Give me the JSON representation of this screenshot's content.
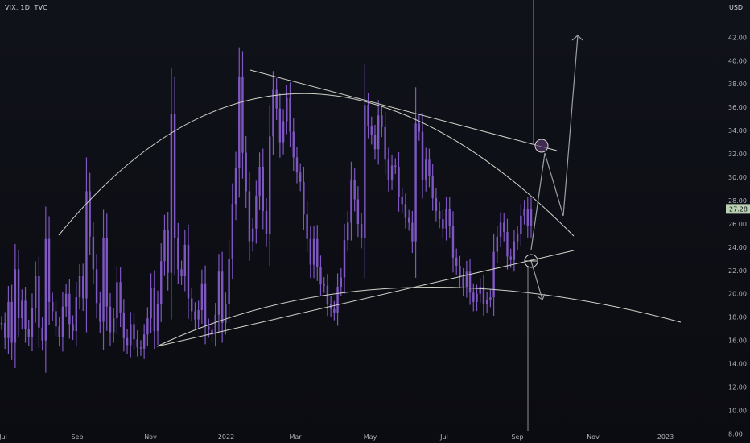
{
  "header": {
    "ticker": "VIX, 1D, TVC"
  },
  "price_axis": {
    "unit": "USD"
  },
  "chart_data": {
    "type": "line",
    "title": "VIX, 1D, TVC",
    "ylabel": "USD",
    "ylim": [
      7.2,
      45.2
    ],
    "y_scale": "linear",
    "grid": false,
    "y_ticks": [
      "8.00",
      "10.00",
      "12.00",
      "14.00",
      "16.00",
      "18.00",
      "20.00",
      "22.00",
      "24.00",
      "26.00",
      "28.00",
      "30.00",
      "32.00",
      "34.00",
      "36.00",
      "38.00",
      "40.00",
      "42.00"
    ],
    "x_ticks": [
      "Jul",
      "Sep",
      "Nov",
      "2022",
      "Mar",
      "May",
      "Jul",
      "Sep",
      "Nov",
      "2023"
    ],
    "last_price": "27.28",
    "series": [
      {
        "values": [
          17.5,
          16.2,
          19.3,
          15.8,
          22.1,
          17.9,
          19.4,
          17.0,
          16.3,
          18.8,
          21.5,
          17.1,
          16.0,
          24.7,
          19.3,
          18.5,
          17.2,
          16.3,
          18.9,
          20.0,
          17.4,
          16.8,
          19.7,
          21.5,
          19.6,
          28.8,
          24.9,
          22.1,
          19.2,
          17.6,
          24.8,
          18.9,
          16.7,
          17.9,
          21.0,
          18.4,
          16.2,
          15.6,
          17.4,
          16.1,
          15.4,
          15.3,
          16.5,
          17.9,
          20.5,
          16.8,
          19.1,
          22.8,
          25.5,
          21.8,
          35.4,
          24.8,
          22.1,
          21.5,
          24.2,
          19.6,
          18.5,
          17.8,
          18.6,
          20.9,
          17.2,
          16.9,
          16.5,
          18.2,
          21.9,
          17.5,
          19.1,
          23.0,
          27.7,
          30.8,
          38.6,
          32.1,
          28.8,
          24.5,
          25.6,
          28.4,
          30.9,
          27.1,
          25.1,
          33.5,
          37.5,
          35.9,
          33.0,
          34.8,
          36.8,
          33.9,
          31.7,
          30.4,
          29.6,
          26.8,
          24.7,
          22.5,
          24.7,
          22.3,
          20.8,
          20.7,
          19.1,
          18.7,
          18.4,
          20.6,
          21.4,
          24.6,
          26.1,
          29.8,
          28.1,
          26.0,
          24.8,
          36.2,
          34.4,
          33.6,
          32.4,
          35.3,
          34.3,
          31.5,
          29.8,
          31.0,
          30.9,
          28.3,
          27.7,
          26.5,
          26.1,
          24.5,
          34.6,
          33.9,
          29.8,
          31.5,
          30.1,
          28.2,
          27.1,
          26.4,
          25.6,
          27.3,
          25.8,
          23.1,
          22.4,
          21.4,
          20.6,
          21.9,
          20.1,
          19.3,
          20.0,
          20.6,
          19.1,
          19.5,
          19.7,
          23.6,
          24.9,
          26.1,
          25.3,
          23.2,
          22.9,
          24.5,
          25.1,
          26.7,
          27.3,
          25.8,
          27.28
        ]
      }
    ],
    "annotations": [
      {
        "kind": "arc",
        "desc": "rounded top arc over price"
      },
      {
        "kind": "arc",
        "desc": "rounded bottom arc"
      },
      {
        "kind": "trendline",
        "from": [
          "2022-01",
          38.7
        ],
        "to": [
          "2022-09",
          31.8
        ]
      },
      {
        "kind": "trendline",
        "from": [
          "2021-11",
          14.8
        ],
        "to": [
          "2022-10",
          23.3
        ]
      },
      {
        "kind": "marker",
        "desc": "circle at upper trendline",
        "price": 32.3
      },
      {
        "kind": "marker",
        "desc": "circle at lower trendline",
        "price": 22.3
      },
      {
        "kind": "arrow",
        "desc": "bullish projection path",
        "target": 42.0
      },
      {
        "kind": "arrow",
        "desc": "bearish projection",
        "target": 19.1
      }
    ]
  },
  "colors": {
    "background": "#131722",
    "candle": "#7e57c2",
    "drawing": "#cfd3c8",
    "marker_fill": "#5c3a70",
    "last_price_tag": "#b9d1b2",
    "axis_text": "#b2b5be"
  }
}
